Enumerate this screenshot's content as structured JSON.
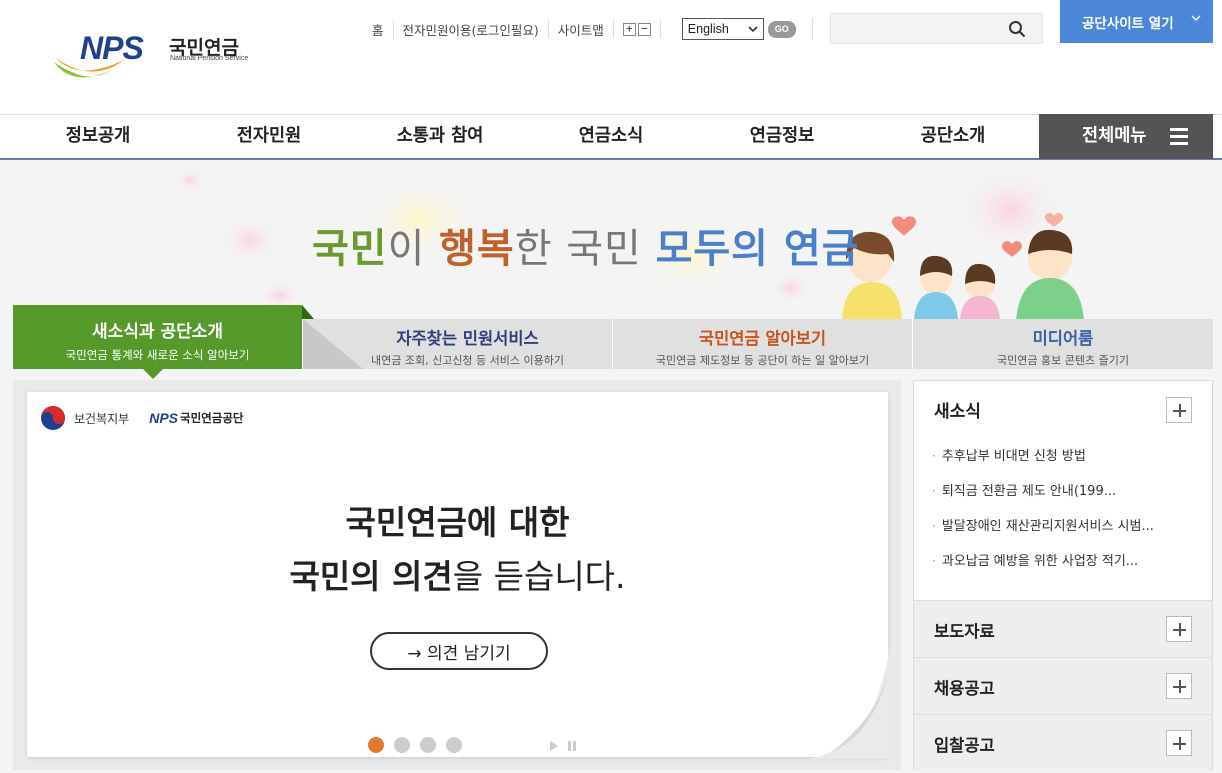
{
  "header": {
    "logo": {
      "brand": "NPS",
      "name_ko": "국민연금",
      "name_en": "National Pension Service"
    },
    "util_links": [
      "홈",
      "전자민원이용(로그인필요)",
      "사이트맵"
    ],
    "font_controls": {
      "increase": "+",
      "decrease": "−"
    },
    "language": {
      "selected": "English",
      "go": "GO"
    },
    "search": {
      "placeholder": "",
      "icon": "search-icon"
    },
    "site_open": "공단사이트 열기"
  },
  "gnb": {
    "items": [
      "정보공개",
      "전자민원",
      "소통과 참여",
      "연금소식",
      "연금정보",
      "공단소개"
    ],
    "all_menu": "전체메뉴"
  },
  "hero": {
    "slogan": {
      "w1": "국민",
      "w2": "이 ",
      "w3": "행복",
      "w4": "한 국민 ",
      "w5": "모두의 연금"
    }
  },
  "tabs": [
    {
      "title": "새소식과 공단소개",
      "sub": "국민연금 통계와 새로운 소식 알아보기",
      "color": "#ffffff"
    },
    {
      "title": "자주찾는 민원서비스",
      "sub": "내연금 조회, 신고신청 등 서비스 이용하기",
      "color": "#2e3f7a"
    },
    {
      "title": "국민연금 알아보기",
      "sub": "국민연금 제도정보 등 공단이 하는 일 알아보기",
      "color": "#c8521a"
    },
    {
      "title": "미디어룸",
      "sub": "국민연금 홍보 콘텐츠 즐기기",
      "color": "#3a5fa8"
    }
  ],
  "slide": {
    "ministry": "보건복지부",
    "org_brand": "NPS",
    "org_name": "국민연금공단",
    "line1": "국민연금에 대한",
    "line2_bold": "국민의 의견",
    "line2_rest": "을 듣습니다.",
    "button": "→ 의견 남기기",
    "pager": {
      "count": 4,
      "active": 1
    }
  },
  "news": {
    "title": "새소식",
    "items": [
      "추후납부 비대면 신청 방법",
      "퇴직금 전환금 제도 안내(199...",
      "발달장애인 재산관리지원서비스 시범...",
      "과오납금 예방을 위한 사업장 적기..."
    ],
    "sections": [
      "보도자료",
      "채용공고",
      "입찰공고"
    ]
  },
  "colors": {
    "accent_green": "#55992a",
    "brand_blue": "#4c86d8",
    "highlight": "#fbf0a4"
  }
}
